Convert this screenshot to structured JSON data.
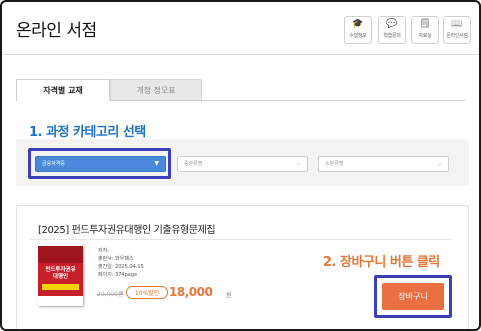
{
  "app": {
    "title": "온라인 서점"
  },
  "quick_menu": [
    {
      "label": "수험정보",
      "icon": "graduation-cap-icon",
      "glyph": "🎓"
    },
    {
      "label": "학습문의",
      "icon": "chat-bubble-icon",
      "glyph": "💬"
    },
    {
      "label": "자료실",
      "icon": "document-icon",
      "glyph": "🗒"
    },
    {
      "label": "온라인서점",
      "icon": "book-icon",
      "glyph": "📖"
    }
  ],
  "tabs": [
    {
      "label": "자격별 교재",
      "active": true
    },
    {
      "label": "개정 정오표",
      "active": false
    }
  ],
  "annotations": {
    "step1": "1. 과정 카테고리 선택",
    "step2": "2. 장바구니 버튼 클릭",
    "highlight_color": "#3b3fb8"
  },
  "filters": {
    "main_category": "금융자격증",
    "middle_category_placeholder": "중분류명",
    "sub_category_placeholder": "소분류명"
  },
  "product": {
    "title": "[2025] 펀드투자권유대행인 기출유형문제집",
    "author_label": "저자:",
    "publisher_label": "출판사: 와우패스",
    "date_label": "출간일: 2025.04.15",
    "pages_label": "페이지: 374page",
    "cover_line1": "펀드투자권유",
    "cover_line2": "대행인",
    "original_price": "20,000원",
    "discount_badge": "10%할인",
    "sale_price": "18,000",
    "currency": "원",
    "cart_button": "장바구니"
  },
  "colors": {
    "accent_blue": "#1e73c8",
    "accent_orange": "#e6773a",
    "select_blue": "#4a89dc",
    "cart_button": "#ea7042"
  }
}
